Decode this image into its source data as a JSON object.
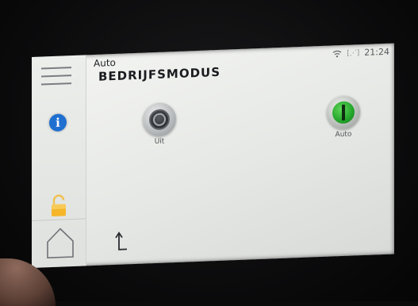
{
  "header": {
    "mode_label": "Auto",
    "title": "BEDRIJFSMODUS"
  },
  "status": {
    "time": "21:24",
    "wifi_icon": "wifi-icon",
    "signal_icon": "signal-icon"
  },
  "sidebar": {
    "icons": [
      "menu-icon",
      "info-icon",
      "lock-icon",
      "home-icon"
    ],
    "info_glyph": "i"
  },
  "modes": [
    {
      "label": "Uit",
      "state": "inactive",
      "color": "#3a3d41"
    },
    {
      "label": "Auto",
      "state": "active",
      "color": "#2fbf35"
    }
  ],
  "footer": {
    "icons": [
      "back-arrow-icon"
    ]
  }
}
